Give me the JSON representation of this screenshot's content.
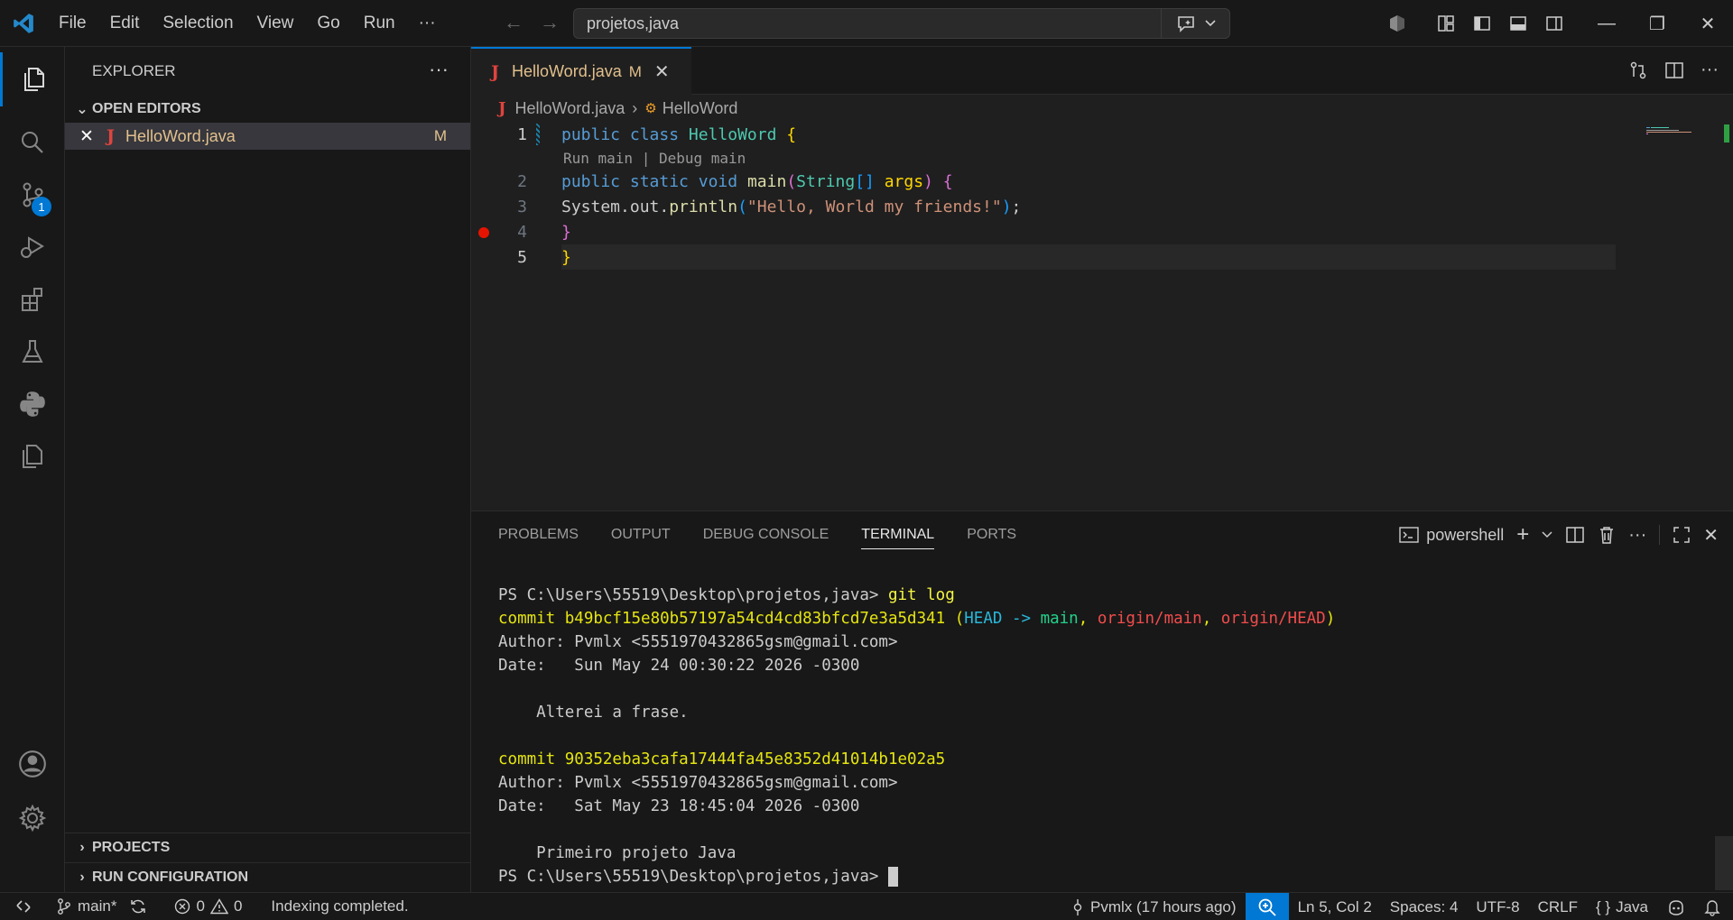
{
  "titlebar": {
    "menu": [
      "File",
      "Edit",
      "Selection",
      "View",
      "Go",
      "Run",
      "···"
    ],
    "command_center": "projetos,java",
    "window_buttons": [
      "—",
      "❐",
      "✕"
    ]
  },
  "activity_bar": {
    "source_control_badge": "1"
  },
  "sidebar": {
    "title": "EXPLORER",
    "open_editors_label": "OPEN EDITORS",
    "open_editor_file": "HelloWord.java",
    "open_editor_status": "M",
    "projects_label": "PROJECTS",
    "run_config_label": "RUN CONFIGURATION"
  },
  "editor": {
    "tab_name": "HelloWord.java",
    "tab_status": "M",
    "breadcrumb_file": "HelloWord.java",
    "breadcrumb_symbol": "HelloWord",
    "code_lens": "Run main | Debug main",
    "line_numbers": [
      "1",
      "2",
      "3",
      "4",
      "5"
    ],
    "line1": {
      "kw1": "public",
      "kw2": "class",
      "name": "HelloWord",
      "brace": "{"
    },
    "line2": {
      "kw1": "public",
      "kw2": "static",
      "kw3": "void",
      "fn": "main",
      "open": "(",
      "type": "String",
      "arr": "[]",
      "param": "args",
      "close": ")",
      "brace": "{"
    },
    "line3": {
      "obj": "System.out.",
      "fn": "println",
      "open": "(",
      "str": "\"Hello, World my friends!\"",
      "close": ")",
      "semi": ";"
    },
    "line4": {
      "brace": "}"
    },
    "line5": {
      "brace": "}"
    }
  },
  "panel": {
    "tabs": [
      "PROBLEMS",
      "OUTPUT",
      "DEBUG CONSOLE",
      "TERMINAL",
      "PORTS"
    ],
    "active_tab": "TERMINAL",
    "shell": "powershell",
    "terminal": {
      "prompt": "PS C:\\Users\\55519\\Desktop\\projetos,java>",
      "command": "git log",
      "commit1_label": "commit b49bcf15e80b57197a54cd4cd83bfcd7e3a5d341",
      "commit1_head": "HEAD",
      "commit1_arrow": " -> ",
      "commit1_main": "main",
      "commit1_origin_main": "origin/main",
      "commit1_origin_head": "origin/HEAD",
      "commit1_author": "Author: Pvmlx <5551970432865gsm@gmail.com>",
      "commit1_date": "Date:   Sun May 24 00:30:22 2026 -0300",
      "commit1_msg": "    Alterei a frase.",
      "commit2_label": "commit 90352eba3cafa17444fa45e8352d41014b1e02a5",
      "commit2_author": "Author: Pvmlx <5551970432865gsm@gmail.com>",
      "commit2_date": "Date:   Sat May 23 18:45:04 2026 -0300",
      "commit2_msg": "    Primeiro projeto Java",
      "final_prompt": "PS C:\\Users\\55519\\Desktop\\projetos,java>"
    }
  },
  "statusbar": {
    "branch": "main*",
    "errors": "0",
    "warnings": "0",
    "message": "Indexing completed.",
    "blame": "Pvmlx (17 hours ago)",
    "position": "Ln 5, Col 2",
    "spaces": "Spaces: 4",
    "encoding": "UTF-8",
    "eol": "CRLF",
    "language_icon": "{ }",
    "language": "Java"
  }
}
